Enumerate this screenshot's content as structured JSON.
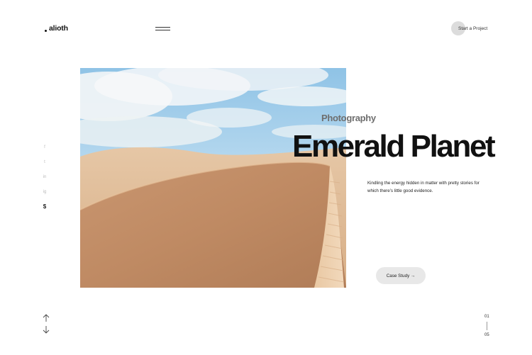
{
  "header": {
    "logo_text": "alioth",
    "cta_label": "Start a Project"
  },
  "hero": {
    "category": "Photography",
    "title": "Emerald Planet",
    "description": "Kindling the energy hidden in matter with pretty stories for which there’s little good evidence.",
    "case_study_label": "Case Study →"
  },
  "social_links": [
    {
      "icon": "facebook-icon",
      "glyph": "f"
    },
    {
      "icon": "twitter-icon",
      "glyph": "t"
    },
    {
      "icon": "linkedin-icon",
      "glyph": "in"
    },
    {
      "icon": "instagram-icon",
      "glyph": "ig"
    },
    {
      "icon": "dribbble-icon",
      "glyph": "$",
      "active": true
    }
  ],
  "slider": {
    "current": "01",
    "total": "05"
  },
  "colors": {
    "background": "#ffffff",
    "text": "#111111",
    "muted": "#6e6e6e",
    "button_bg": "#e8e8e8",
    "sand": "#c9986a",
    "sky": "#a9d0ea"
  }
}
